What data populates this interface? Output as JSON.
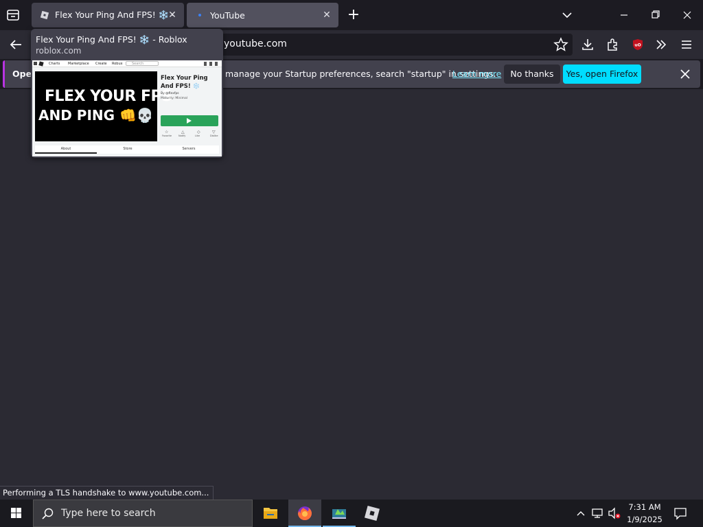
{
  "tabs": [
    {
      "title": "Flex Your Ping And FPS! ❄️ - Roblox",
      "close": "✕"
    },
    {
      "title": "YouTube",
      "close": "✕"
    }
  ],
  "new_tab": "+",
  "window_controls": {
    "minimize": "—",
    "restore": "❐",
    "close": "✕"
  },
  "url": "youtube.com",
  "notification": {
    "prefix": "Oper",
    "text": "manage your Startup preferences, search \"startup\" in settings.",
    "link": "Learn more",
    "no_thanks": "No thanks",
    "yes_open": "Yes, open Firefox"
  },
  "preview": {
    "title": "Flex Your Ping And FPS! ❄️ - Roblox",
    "domain": "roblox.com",
    "thumb": {
      "nav": [
        "Charts",
        "Marketplace",
        "Create",
        "Robux"
      ],
      "search": "Search",
      "banner_line1": "FLEX YOUR FPS",
      "banner_line2": "AND PING 👊💀",
      "game_title": "Flex Your Ping And FPS! ❄️",
      "by": "By @flexfps",
      "maturity": "Maturity: Minimal",
      "tabs": [
        "About",
        "Store",
        "Servers"
      ],
      "actions": [
        "Favorite",
        "Notify",
        "Like",
        "Dislike"
      ]
    }
  },
  "status": "Performing a TLS handshake to www.youtube.com...",
  "taskbar": {
    "search_placeholder": "Type here to search",
    "time": "7:31 AM",
    "date": "1/9/2025"
  },
  "colors": {
    "accent_button": "#00ddff",
    "link": "#80ebff",
    "ublock": "#c1121f"
  }
}
